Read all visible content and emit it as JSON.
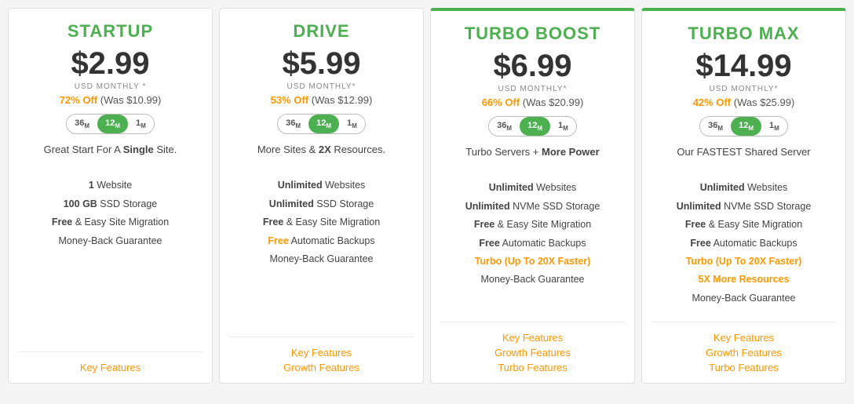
{
  "plans": [
    {
      "id": "startup",
      "name": "STARTUP",
      "price": "$2.99",
      "period": "USD MONTHLY *",
      "discount_off": "72% Off",
      "discount_was": "(Was $10.99)",
      "tagline": "Great Start For A <strong>Single</strong> Site.",
      "features": [
        {
          "text": "<strong>1</strong> Website"
        },
        {
          "text": "<strong>100 GB</strong> SSD Storage"
        },
        {
          "text": "<strong>Free</strong> & Easy Site Migration"
        },
        {
          "text": "Money-Back Guarantee"
        }
      ],
      "links": [
        "Key Features"
      ],
      "featured": false
    },
    {
      "id": "drive",
      "name": "DRIVE",
      "price": "$5.99",
      "period": "USD MONTHLY*",
      "discount_off": "53% Off",
      "discount_was": "(Was $12.99)",
      "tagline": "More Sites & <strong>2X</strong> Resources.",
      "features": [
        {
          "text": "<strong>Unlimited</strong> Websites"
        },
        {
          "text": "<strong>Unlimited</strong> SSD Storage"
        },
        {
          "text": "<strong>Free</strong> & Easy Site Migration"
        },
        {
          "text": "<span class='orange'>Free</span> Automatic Backups"
        },
        {
          "text": "Money-Back Guarantee"
        }
      ],
      "links": [
        "Key Features",
        "Growth Features"
      ],
      "featured": false
    },
    {
      "id": "turbo-boost",
      "name": "TURBO BOOST",
      "price": "$6.99",
      "period": "USD MONTHLY*",
      "discount_off": "66% Off",
      "discount_was": "(Was $20.99)",
      "tagline": "Turbo Servers + <strong>More Power</strong>",
      "features": [
        {
          "text": "<strong>Unlimited</strong> Websites"
        },
        {
          "text": "<strong>Unlimited</strong> NVMe SSD Storage"
        },
        {
          "text": "<strong>Free</strong> & Easy Site Migration"
        },
        {
          "text": "<strong>Free</strong> Automatic Backups"
        },
        {
          "text": "<span class='orange'>Turbo (Up To 20X Faster)</span>"
        },
        {
          "text": "Money-Back Guarantee"
        }
      ],
      "links": [
        "Key Features",
        "Growth Features",
        "Turbo Features"
      ],
      "featured": true
    },
    {
      "id": "turbo-max",
      "name": "TURBO MAX",
      "price": "$14.99",
      "period": "USD MONTHLY*",
      "discount_off": "42% Off",
      "discount_was": "(Was $25.99)",
      "tagline": "Our FASTEST Shared Server",
      "features": [
        {
          "text": "<strong>Unlimited</strong> Websites"
        },
        {
          "text": "<strong>Unlimited</strong> NVMe SSD Storage"
        },
        {
          "text": "<strong>Free</strong> & Easy Site Migration"
        },
        {
          "text": "<strong>Free</strong> Automatic Backups"
        },
        {
          "text": "<span class='orange'>Turbo (Up To 20X Faster)</span>"
        },
        {
          "text": "<span class='orange'>5X More Resources</span>"
        },
        {
          "text": "Money-Back Guarantee"
        }
      ],
      "links": [
        "Key Features",
        "Growth Features",
        "Turbo Features"
      ],
      "featured": true
    }
  ],
  "billing_options": [
    "36 M",
    "12 M",
    "1 M"
  ],
  "active_billing": "12 M"
}
